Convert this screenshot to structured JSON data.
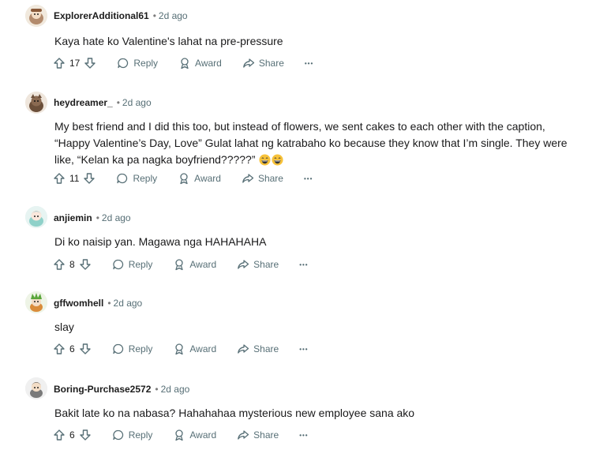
{
  "comments": [
    {
      "author": "ExplorerAdditional61",
      "time": "2d ago",
      "text": "Kaya hate ko Valentine's lahat na pre-pressure",
      "votes": "17",
      "avatar_color": "#b38b6d"
    },
    {
      "author": "heydreamer_",
      "time": "2d ago",
      "text": "My best friend and I did this too, but instead of flowers, we sent cakes to each other with the caption, “Happy Valentine’s Day, Love” Gulat lahat ng katrabaho ko because they know that I’m single. They were like, “Kelan ka pa nagka boyfriend?????”",
      "votes": "11",
      "avatar_color": "#6b4f3a"
    },
    {
      "author": "anjiemin",
      "time": "2d ago",
      "text": "Di ko naisip yan. Magawa nga HAHAHAHA",
      "votes": "8",
      "avatar_color": "#8fd1c9"
    },
    {
      "author": "gffwomhell",
      "time": "2d ago",
      "text": "slay",
      "votes": "6",
      "avatar_color": "#5aa63b"
    },
    {
      "author": "Boring-Purchase2572",
      "time": "2d ago",
      "text": "Bakit late ko na nabasa? Hahahahaa mysterious new employee sana ako",
      "votes": "6",
      "avatar_color": "#7a7a7a"
    }
  ],
  "actions": {
    "reply": "Reply",
    "award": "Award",
    "share": "Share",
    "more": "•••"
  },
  "meta_separator": "•"
}
